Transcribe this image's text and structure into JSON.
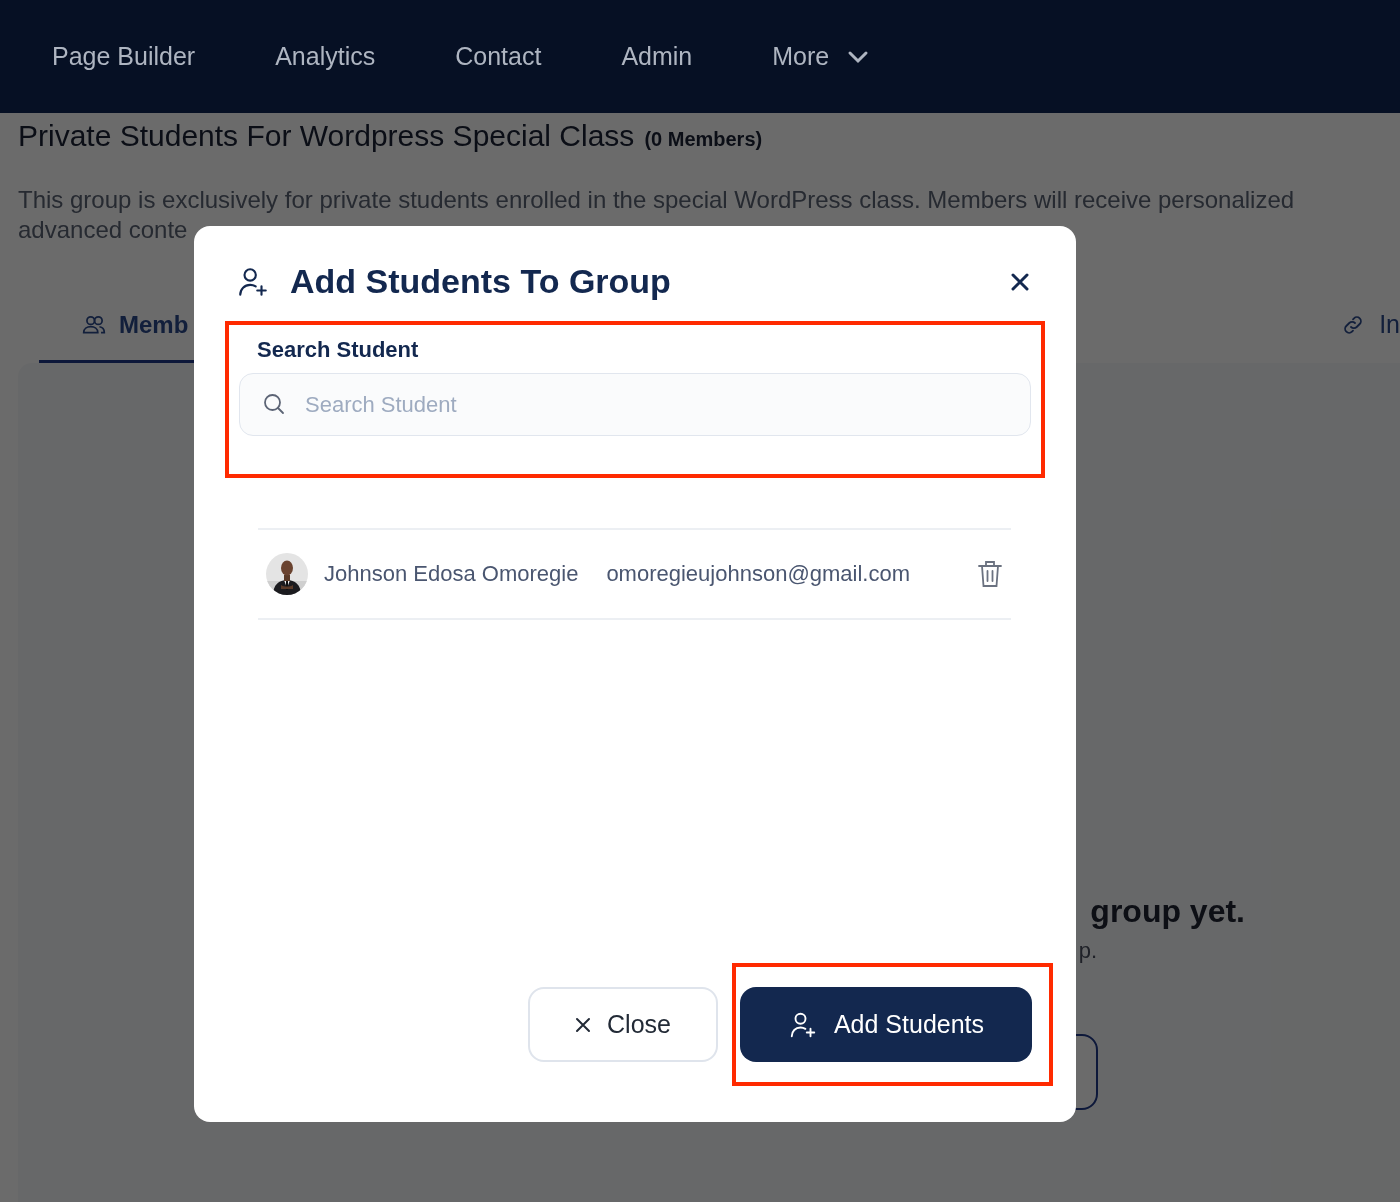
{
  "nav": {
    "items": [
      {
        "label": "Page Builder",
        "dropdown": false
      },
      {
        "label": "Analytics",
        "dropdown": false
      },
      {
        "label": "Contact",
        "dropdown": false
      },
      {
        "label": "Admin",
        "dropdown": false
      },
      {
        "label": "More",
        "dropdown": true
      }
    ]
  },
  "group": {
    "title": "Private Students For Wordpress Special Class",
    "member_count": "(0 Members)",
    "description": [
      "This group is exclusively for private students enrolled in the special WordPress class. Members will receive personalized",
      "advanced conte"
    ]
  },
  "tabs": [
    {
      "label": "Memb",
      "selected": true,
      "kind": "members"
    },
    {
      "label": "In",
      "selected": false,
      "kind": "link"
    }
  ],
  "empty_state": {
    "message": "group yet.",
    "hint": "p."
  },
  "modal": {
    "title": "Add Students To Group",
    "search": {
      "label": "Search Student",
      "placeholder": "Search Student",
      "highlighted": true
    },
    "students": [
      {
        "name": "Johnson Edosa Omoregie",
        "email": "omoregieujohnson@gmail.com"
      }
    ],
    "buttons": [
      {
        "kind": "secondary",
        "label": "Close",
        "highlighted": false
      },
      {
        "kind": "primary",
        "label": "Add Students",
        "highlighted": true
      }
    ]
  }
}
